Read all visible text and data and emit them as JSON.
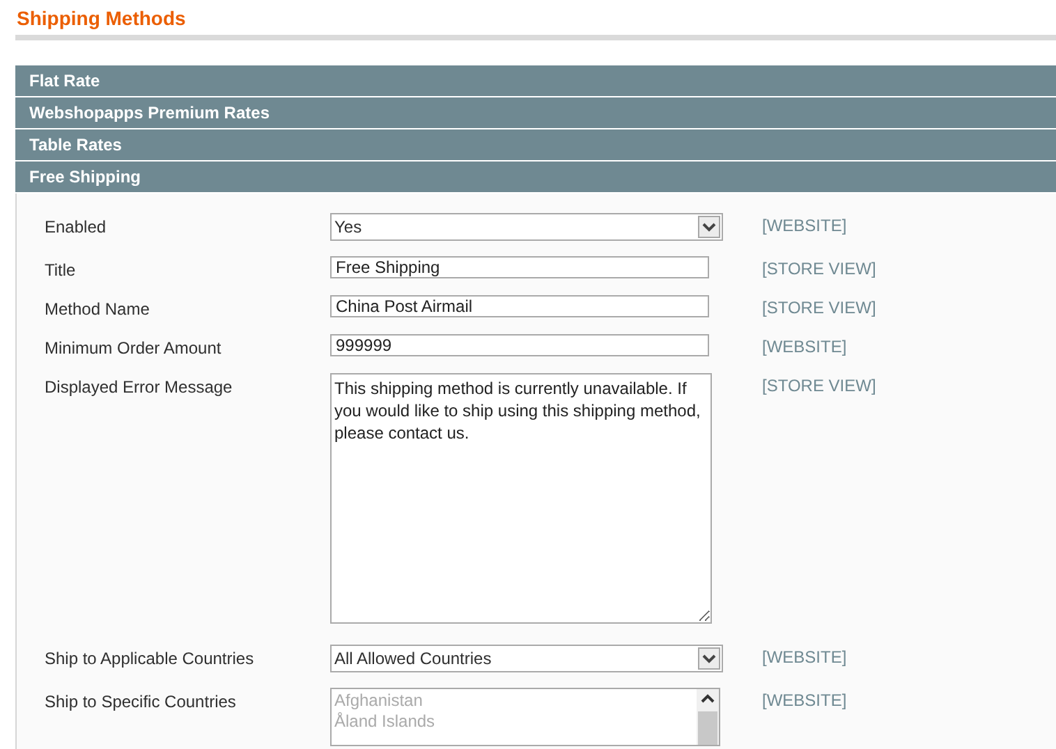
{
  "page_title": "Shipping Methods",
  "sections": [
    {
      "title": "Flat Rate"
    },
    {
      "title": "Webshopapps Premium Rates"
    },
    {
      "title": "Table Rates"
    },
    {
      "title": "Free Shipping",
      "fields": [
        {
          "kind": "select",
          "label": "Enabled",
          "value": "Yes",
          "scope": "[WEBSITE]"
        },
        {
          "kind": "text",
          "label": "Title",
          "value": "Free Shipping",
          "scope": "[STORE VIEW]"
        },
        {
          "kind": "text",
          "label": "Method Name",
          "value": "China Post Airmail",
          "scope": "[STORE VIEW]"
        },
        {
          "kind": "text",
          "label": "Minimum Order Amount",
          "value": "999999",
          "scope": "[WEBSITE]"
        },
        {
          "kind": "textarea",
          "label": "Displayed Error Message",
          "value": "This shipping method is currently unavailable. If you would like to ship using this shipping method, please contact us.",
          "scope": "[STORE VIEW]"
        },
        {
          "kind": "select",
          "label": "Ship to Applicable Countries",
          "value": "All Allowed Countries",
          "scope": "[WEBSITE]"
        },
        {
          "kind": "multiselect",
          "label": "Ship to Specific Countries",
          "options": [
            "Afghanistan",
            "Åland Islands"
          ],
          "disabled": true,
          "scope": "[WEBSITE]"
        }
      ]
    }
  ]
}
